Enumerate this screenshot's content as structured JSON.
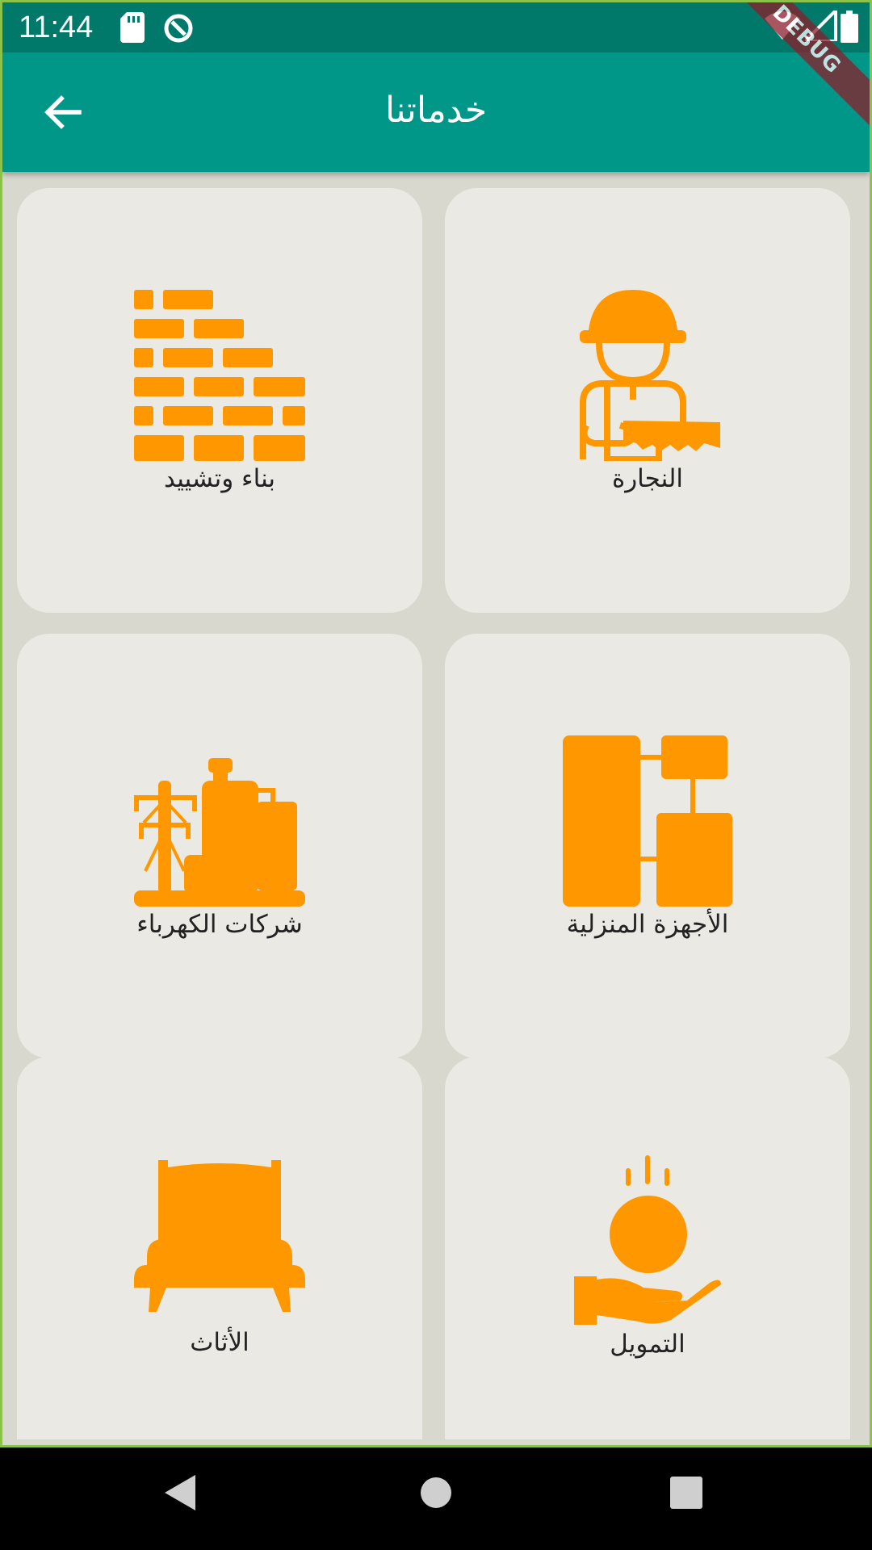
{
  "status_bar": {
    "time": "11:44",
    "icons": [
      "sd-card-icon",
      "sync-icon",
      "wifi-icon",
      "signal-icon",
      "battery-icon"
    ]
  },
  "app_bar": {
    "title": "خدماتنا",
    "back_icon": "arrow-back-icon"
  },
  "debug_ribbon": "DEBUG",
  "colors": {
    "primary": "#009688",
    "primary_dark": "#00796b",
    "accent": "#ff9800",
    "card": "#ebe9e3",
    "background": "#d9d8ce"
  },
  "services": [
    {
      "label": "بناء وتشييد",
      "icon": "brick-wall-icon"
    },
    {
      "label": "النجارة",
      "icon": "carpenter-icon"
    },
    {
      "label": "شركات الكهرباء",
      "icon": "power-plant-icon"
    },
    {
      "label": "الأجهزة المنزلية",
      "icon": "appliances-icon"
    },
    {
      "label": "الأثاث",
      "icon": "bed-icon"
    },
    {
      "label": "التمويل",
      "icon": "finance-hand-coin-icon"
    }
  ],
  "nav": [
    "back-nav-icon",
    "home-nav-icon",
    "recents-nav-icon"
  ]
}
